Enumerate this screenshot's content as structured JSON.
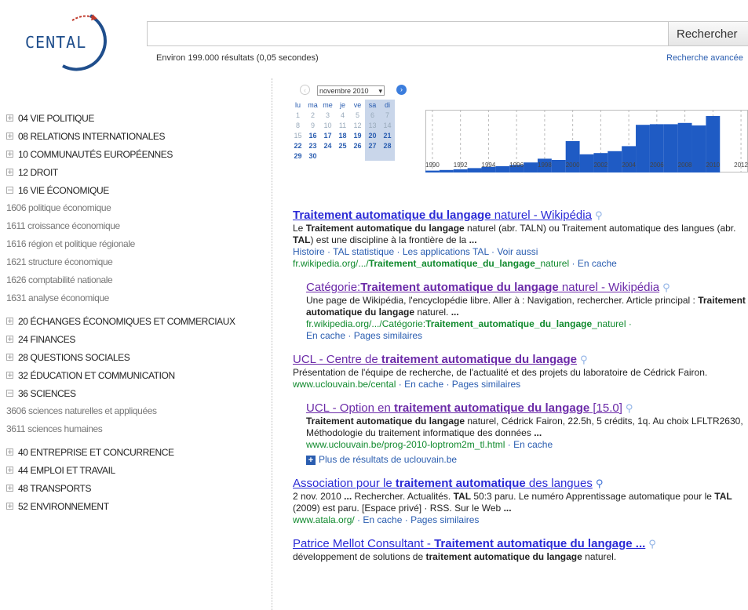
{
  "logo": {
    "text": "CENTAL"
  },
  "search": {
    "query": "",
    "button": "Rechercher",
    "stats": "Environ 199.000 résultats (0,05 secondes)",
    "advanced": "Recherche avancée"
  },
  "tree": [
    {
      "type": "cat",
      "toggle": "+",
      "label": "04 VIE POLITIQUE"
    },
    {
      "type": "cat",
      "toggle": "+",
      "label": "08 RELATIONS INTERNATIONALES"
    },
    {
      "type": "cat",
      "toggle": "+",
      "label": "10 COMMUNAUTÉS EUROPÉENNES"
    },
    {
      "type": "cat",
      "toggle": "+",
      "label": "12 DROIT"
    },
    {
      "type": "cat",
      "toggle": "−",
      "label": "16 VIE ÉCONOMIQUE"
    },
    {
      "type": "sub",
      "label": "1606 politique économique"
    },
    {
      "type": "sub",
      "label": "1611 croissance économique"
    },
    {
      "type": "sub",
      "label": "1616 région et politique régionale"
    },
    {
      "type": "sub",
      "label": "1621 structure économique"
    },
    {
      "type": "sub",
      "label": "1626 comptabilité nationale"
    },
    {
      "type": "sub",
      "label": "1631 analyse économique"
    },
    {
      "type": "gap"
    },
    {
      "type": "cat",
      "toggle": "+",
      "label": "20 ÉCHANGES ÉCONOMIQUES ET COMMERCIAUX"
    },
    {
      "type": "cat",
      "toggle": "+",
      "label": "24 FINANCES"
    },
    {
      "type": "cat",
      "toggle": "+",
      "label": "28 QUESTIONS SOCIALES"
    },
    {
      "type": "cat",
      "toggle": "+",
      "label": "32 ÉDUCATION ET COMMUNICATION"
    },
    {
      "type": "cat",
      "toggle": "−",
      "label": "36 SCIENCES"
    },
    {
      "type": "sub",
      "label": "3606 sciences naturelles et appliquées"
    },
    {
      "type": "sub",
      "label": "3611 sciences humaines"
    },
    {
      "type": "gap"
    },
    {
      "type": "cat",
      "toggle": "+",
      "label": "40 ENTREPRISE ET CONCURRENCE"
    },
    {
      "type": "cat",
      "toggle": "+",
      "label": "44 EMPLOI ET TRAVAIL"
    },
    {
      "type": "cat",
      "toggle": "+",
      "label": "48 TRANSPORTS"
    },
    {
      "type": "cat",
      "toggle": "+",
      "label": "52 ENVIRONNEMENT"
    }
  ],
  "calendar": {
    "month": "novembre 2010",
    "nav_prev": "‹",
    "nav_next": "›",
    "days": [
      "lu",
      "ma",
      "me",
      "je",
      "ve",
      "sa",
      "di"
    ],
    "weeks": [
      [
        "1",
        "2",
        "3",
        "4",
        "5",
        "6",
        "7"
      ],
      [
        "8",
        "9",
        "10",
        "11",
        "12",
        "13",
        "14"
      ],
      [
        "15",
        "16",
        "17",
        "18",
        "19",
        "20",
        "21"
      ],
      [
        "22",
        "23",
        "24",
        "25",
        "26",
        "27",
        "28"
      ],
      [
        "29",
        "30",
        "",
        "",
        "",
        "",
        ""
      ]
    ],
    "first_active_day": "16"
  },
  "chart_data": {
    "type": "bar",
    "title": "",
    "xlabel": "",
    "ylabel": "",
    "x": [
      1990,
      1991,
      1992,
      1993,
      1994,
      1995,
      1996,
      1997,
      1998,
      1999,
      2000,
      2001,
      2002,
      2003,
      2004,
      2005,
      2006,
      2007,
      2008,
      2009,
      2010,
      2011,
      2012
    ],
    "values": [
      3,
      4,
      5,
      7,
      9,
      10,
      12,
      16,
      22,
      20,
      50,
      29,
      31,
      34,
      42,
      76,
      77,
      77,
      79,
      75,
      90,
      0,
      0
    ],
    "ylim": [
      0,
      100
    ],
    "xticks": [
      "1990",
      "1992",
      "1994",
      "1996",
      "1998",
      "2000",
      "2002",
      "2004",
      "2006",
      "2008",
      "2010",
      "2012"
    ],
    "bar_color": "#1f5bc4",
    "grid": true
  },
  "results": [
    {
      "indent": false,
      "visited": false,
      "mag_dark": false,
      "title": [
        {
          "t": "Traitement automatique du langage",
          "b": true
        },
        {
          "t": " naturel - Wikipédia",
          "b": false
        }
      ],
      "snippet": [
        {
          "t": "Le ",
          "b": false
        },
        {
          "t": "Traitement automatique du langage",
          "b": true
        },
        {
          "t": " naturel (abr. TALN) ou Traitement automatique des langues (abr. ",
          "b": false
        },
        {
          "t": "TAL",
          "b": true
        },
        {
          "t": ") est une discipline à la frontière de la ",
          "b": false
        },
        {
          "t": "...",
          "b": true
        }
      ],
      "sitelinks": "Histoire · TAL statistique · Les applications TAL · Voir aussi",
      "url": [
        {
          "t": "fr.wikipedia.org/.../",
          "b": false
        },
        {
          "t": "Traitement_automatique_du_langage",
          "b": true
        },
        {
          "t": "_naturel",
          "b": false
        }
      ],
      "cache": " · En cache"
    },
    {
      "indent": true,
      "visited": true,
      "mag_dark": false,
      "title": [
        {
          "t": "Catégorie:",
          "b": false
        },
        {
          "t": "Traitement automatique du langage",
          "b": true
        },
        {
          "t": " naturel - Wikipédia",
          "b": false
        }
      ],
      "snippet": [
        {
          "t": "Une page de Wikipédia, l'encyclopédie libre. Aller à : Navigation, rechercher. Article principal : ",
          "b": false
        },
        {
          "t": "Traitement automatique du langage",
          "b": true
        },
        {
          "t": " naturel. ",
          "b": false
        },
        {
          "t": "...",
          "b": true
        }
      ],
      "sitelinks": "",
      "url": [
        {
          "t": "fr.wikipedia.org/.../Catégorie:",
          "b": false
        },
        {
          "t": "Traitement_automatique_du_langage",
          "b": true
        },
        {
          "t": "_naturel ·",
          "b": false
        }
      ],
      "cache": "En cache · Pages similaires",
      "cache_newline": true
    },
    {
      "indent": false,
      "visited": true,
      "mag_dark": false,
      "title": [
        {
          "t": "UCL - Centre de ",
          "b": false
        },
        {
          "t": "traitement automatique du langage",
          "b": true
        }
      ],
      "snippet": [
        {
          "t": "Présentation de l'équipe de recherche, de l'actualité et des projets du laboratoire de Cédrick Fairon.",
          "b": false
        }
      ],
      "sitelinks": "",
      "url": [
        {
          "t": "www.uclouvain.be/cental",
          "b": false
        }
      ],
      "cache": " · En cache · Pages similaires"
    },
    {
      "indent": true,
      "visited": true,
      "mag_dark": false,
      "title": [
        {
          "t": "UCL - Option en ",
          "b": false
        },
        {
          "t": "traitement automatique du langage",
          "b": true
        },
        {
          "t": " [15.0]",
          "b": false
        }
      ],
      "snippet": [
        {
          "t": "Traitement automatique du langage",
          "b": true
        },
        {
          "t": " naturel, Cédrick Fairon, 22.5h, 5 crédits, 1q. Au choix LFLTR2630, Méthodologie du traitement informatique des données ",
          "b": false
        },
        {
          "t": "...",
          "b": true
        }
      ],
      "sitelinks": "",
      "url": [
        {
          "t": "www.uclouvain.be/prog-2010-loptrom2m_tl.html",
          "b": false
        }
      ],
      "cache": " · En cache",
      "more": "Plus de résultats de uclouvain.be"
    },
    {
      "indent": false,
      "visited": false,
      "mag_dark": true,
      "title": [
        {
          "t": "Association pour le ",
          "b": false
        },
        {
          "t": "traitement automatique",
          "b": true
        },
        {
          "t": " des langues",
          "b": false
        }
      ],
      "snippet": [
        {
          "t": "2 nov. 2010 ",
          "b": false
        },
        {
          "t": "...",
          "b": true
        },
        {
          "t": " Rechercher. Actualités. ",
          "b": false
        },
        {
          "t": "TAL",
          "b": true
        },
        {
          "t": " 50:3 paru. Le numéro Apprentissage automatique pour le ",
          "b": false
        },
        {
          "t": "TAL",
          "b": true
        },
        {
          "t": " (2009) est paru. [Espace privé] · RSS. Sur le Web ",
          "b": false
        },
        {
          "t": "...",
          "b": true
        }
      ],
      "sitelinks": "",
      "url": [
        {
          "t": "www.atala.org/",
          "b": false
        }
      ],
      "cache": " · En cache · Pages similaires"
    },
    {
      "indent": false,
      "visited": false,
      "mag_dark": false,
      "title": [
        {
          "t": "Patrice Mellot Consultant - ",
          "b": false
        },
        {
          "t": "Traitement automatique du langage ...",
          "b": true
        }
      ],
      "snippet": [
        {
          "t": "développement de solutions de ",
          "b": false
        },
        {
          "t": "traitement automatique du langage",
          "b": true
        },
        {
          "t": " naturel.",
          "b": false
        }
      ],
      "sitelinks": "",
      "url": [],
      "cache": ""
    }
  ]
}
